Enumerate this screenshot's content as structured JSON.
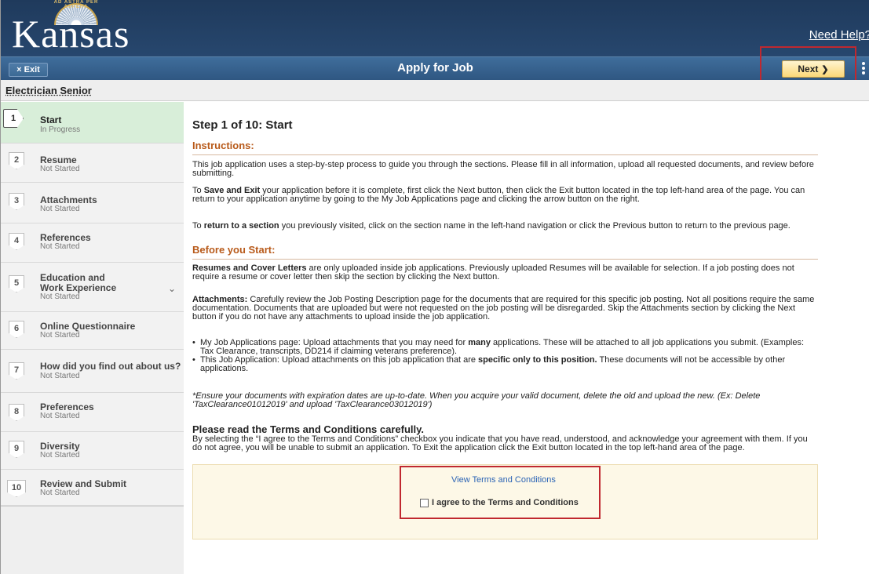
{
  "header": {
    "logo_text": "Kansas",
    "logo_arc_text": "AD ASTRA PER ASPERA",
    "need_help": "Need Help?"
  },
  "titlebar": {
    "exit_label": "Exit",
    "exit_icon": "×",
    "title": "Apply for Job",
    "next_label": "Next",
    "next_icon": "❯"
  },
  "job": {
    "title": "Electrician Senior"
  },
  "sidebar": {
    "steps": [
      {
        "num": "1",
        "label": "Start",
        "status": "In Progress"
      },
      {
        "num": "2",
        "label": "Resume",
        "status": "Not Started"
      },
      {
        "num": "3",
        "label": "Attachments",
        "status": "Not Started"
      },
      {
        "num": "4",
        "label": "References",
        "status": "Not Started"
      },
      {
        "num": "5",
        "label": "Education and Work Experience",
        "status": "Not Started"
      },
      {
        "num": "6",
        "label": "Online Questionnaire",
        "status": "Not Started"
      },
      {
        "num": "7",
        "label": "How did you find out about us?",
        "status": "Not Started"
      },
      {
        "num": "8",
        "label": "Preferences",
        "status": "Not Started"
      },
      {
        "num": "9",
        "label": "Diversity",
        "status": "Not Started"
      },
      {
        "num": "10",
        "label": "Review and Submit",
        "status": "Not Started"
      }
    ]
  },
  "main": {
    "step_heading": "Step 1 of 10: Start",
    "instructions_head": "Instructions:",
    "p1": "This job application uses a step-by-step process to guide you through the sections. Please fill in all information, upload all requested documents, and review before submitting.",
    "p2_pre": "To ",
    "p2_bold": "Save and Exit",
    "p2_post": " your application before it is complete, first click the Next button, then click the Exit button located in the top left-hand area of the page. You can return to your application anytime by going to the My Job Applications page and clicking the arrow button on the right.",
    "p3_pre": "To ",
    "p3_bold": "return to a section",
    "p3_post": " you previously visited, click on the section name in the left-hand navigation or click the Previous button to return to the previous page.",
    "before_head": "Before you Start:",
    "p4_bold": "Resumes and Cover Letters",
    "p4_post": " are only uploaded inside job applications. Previously uploaded Resumes will be available for selection. If a job posting does not require a resume or cover letter then skip the section by clicking the Next button.",
    "p5_bold": "Attachments:",
    "p5_post": " Carefully review the Job Posting Description page for the documents that are required for this specific job posting. Not all positions require the same documentation. Documents that are uploaded but were not requested on the job posting will be disregarded. Skip the Attachments section by clicking the Next button if you do not have any attachments to upload inside the job application.",
    "b1_pre": "My Job Applications page: Upload attachments that you may need for ",
    "b1_bold": "many",
    "b1_post": " applications. These will be attached to all job applications you submit. (Examples: Tax Clearance, transcripts, DD214 if claiming veterans preference).",
    "b2_pre": "This Job Application: Upload attachments on this job application that are ",
    "b2_bold": "specific only to this position.",
    "b2_post": " These documents will not be accessible by other applications.",
    "p6": "*Ensure your documents with expiration dates are up-to-date. When you acquire your valid document, delete the old and upload the new. (Ex: Delete 'TaxClearance01012019' and upload 'TaxClearance03012019')",
    "terms_head": "Please read the Terms and Conditions carefully.",
    "p7": "By selecting the “I agree to the Terms and Conditions” checkbox you indicate that you have read, understood, and acknowledge your agreement with them. If you do not agree, you will be unable to submit an application. To Exit the application click the Exit button located in the top left-hand area of the page.",
    "terms_link": "View Terms and Conditions",
    "agree_label": "I agree to the Terms and Conditions",
    "agree_checked": false
  },
  "colors": {
    "banner": "#1f3a5c",
    "titlebar": "#3f6d9b",
    "next_button": "#fbd878",
    "active_step": "#d8eed9",
    "section_heading": "#b85a1a",
    "link": "#2c64b5",
    "highlight": "#c0282f",
    "terms_box": "#fdf8e7"
  }
}
